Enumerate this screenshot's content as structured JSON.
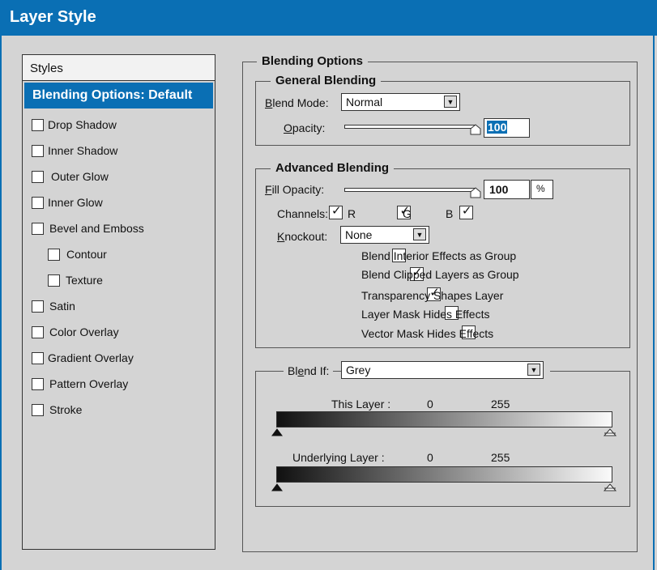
{
  "dialog": {
    "title": "Layer Style"
  },
  "styles": {
    "header": "Styles",
    "selected": "Blending Options: Default",
    "items": [
      {
        "label": "Drop Shadow",
        "checked": false
      },
      {
        "label": "Inner Shadow",
        "checked": false
      },
      {
        "label": "Outer Glow",
        "checked": false
      },
      {
        "label": "Inner Glow",
        "checked": false
      },
      {
        "label": "Bevel and Emboss",
        "checked": false
      },
      {
        "label": "Contour",
        "checked": false
      },
      {
        "label": "Texture",
        "checked": false
      },
      {
        "label": "Satin",
        "checked": false
      },
      {
        "label": "Color Overlay",
        "checked": false
      },
      {
        "label": "Gradient Overlay",
        "checked": false
      },
      {
        "label": "Pattern Overlay",
        "checked": false
      },
      {
        "label": "Stroke",
        "checked": false
      }
    ]
  },
  "blending_options": {
    "title": "Blending Options",
    "general": {
      "title": "General Blending",
      "blend_mode_label": "Blend Mode:",
      "blend_mode_value": "Normal",
      "opacity_label": "Opacity:",
      "opacity_value": "100"
    },
    "advanced": {
      "title": "Advanced Blending",
      "fill_opacity_label": "Fill Opacity:",
      "fill_opacity_value": "100",
      "percent": "%",
      "channels_label": "Channels:",
      "channels": [
        {
          "label": "R",
          "checked": true
        },
        {
          "label": "G",
          "checked": true
        },
        {
          "label": "B",
          "checked": true
        }
      ],
      "knockout_label": "Knockout:",
      "knockout_value": "None",
      "options": [
        {
          "label": "Blend Interior  Effects as Group",
          "checked": false
        },
        {
          "label": "Blend Clipped Layers as Group",
          "checked": true
        },
        {
          "label": "Transparency  Shapes Layer",
          "checked": true
        },
        {
          "label": "Layer Mask Hides Effects",
          "checked": false
        },
        {
          "label": "Vector Mask Hides Effects",
          "checked": false
        }
      ]
    },
    "blend_if": {
      "label": "Blend If:",
      "value": "Grey",
      "this_layer": {
        "label": "This Layer :",
        "min": "0",
        "max": "255"
      },
      "underlying_layer": {
        "label": "Underlying Layer :",
        "min": "0",
        "max": "255"
      }
    }
  },
  "colors": {
    "accent": "#0a6fb4",
    "background": "#d4d4d4"
  },
  "check_glyph": "✓",
  "icons": {
    "dropdown_arrow": "triangle-down-icon",
    "slider_thumb": "pentagon-thumb-icon",
    "range_marker": "triangle-up-icon"
  }
}
